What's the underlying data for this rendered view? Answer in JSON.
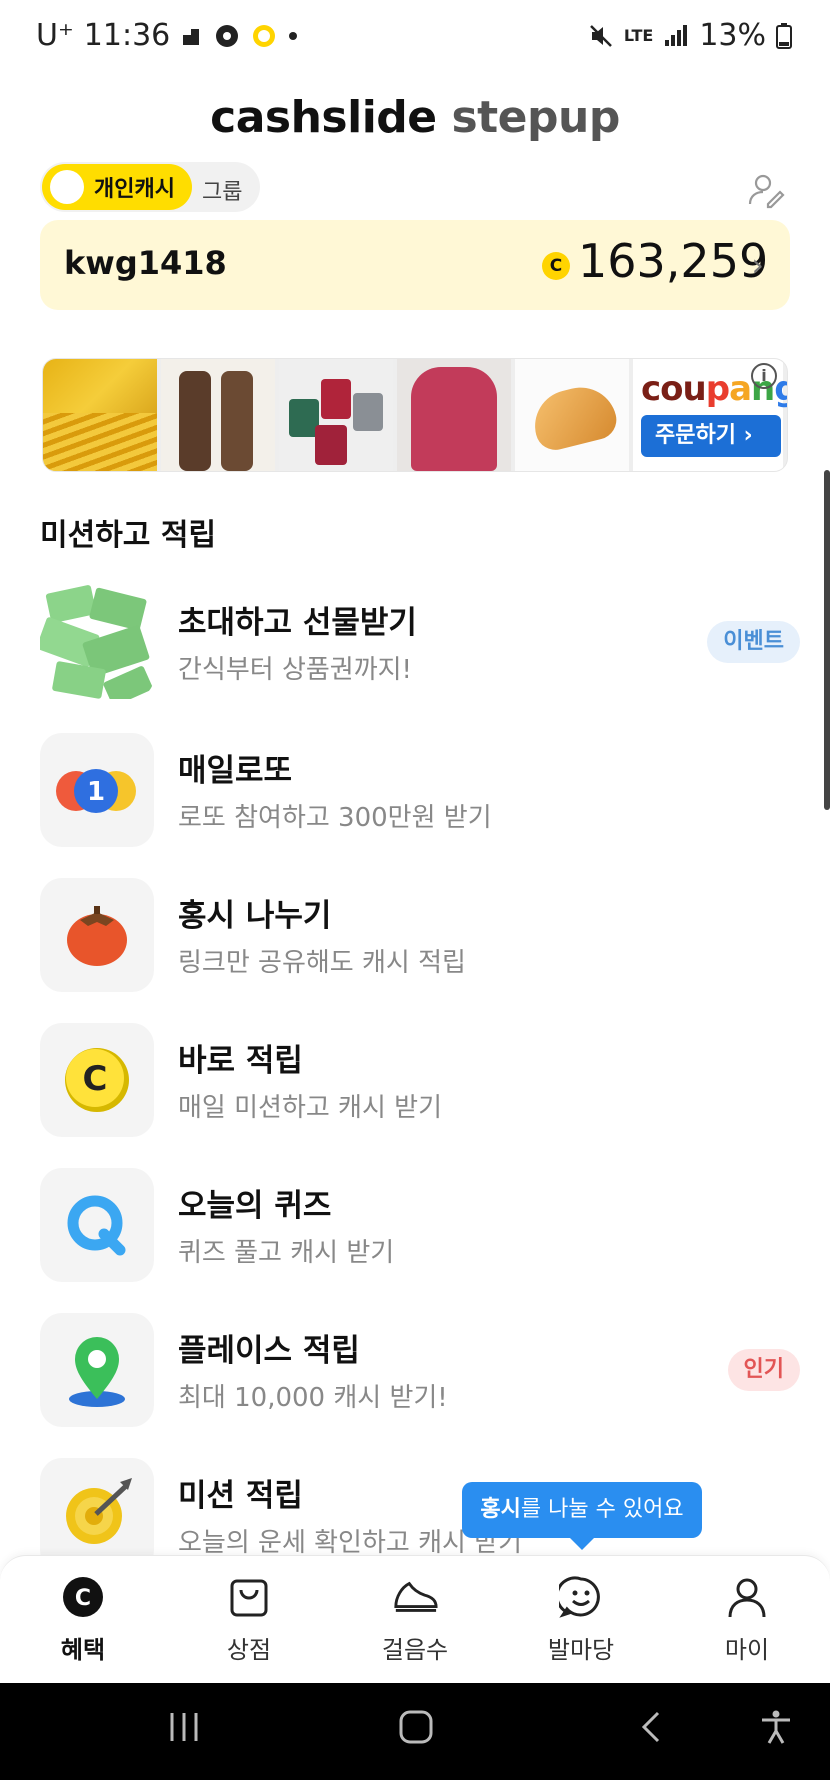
{
  "status_bar": {
    "carrier": "U⁺",
    "time": "11:36",
    "network": "LTE",
    "battery": "13%"
  },
  "header": {
    "title_part1": "cashslide",
    "title_part2": "stepup"
  },
  "toggle": {
    "active_label": "개인캐시",
    "inactive_label": "그룹"
  },
  "account": {
    "user_id": "kwg1418",
    "coin_symbol": "C",
    "balance": "163,259"
  },
  "ad": {
    "brand_parts": [
      "cou",
      "p",
      "a",
      "n",
      "g"
    ],
    "order_button": "주문하기 ›",
    "info": "i"
  },
  "section": {
    "title": "미션하고 적립"
  },
  "missions": [
    {
      "title": "초대하고 선물받기",
      "subtitle": "간식부터 상품권까지!",
      "badge": "이벤트",
      "icon": "money-icon"
    },
    {
      "title": "매일로또",
      "subtitle": "로또 참여하고 300만원 받기",
      "badge": "",
      "icon": "lotto-ball-icon"
    },
    {
      "title": "홍시 나누기",
      "subtitle": "링크만 공유해도 캐시 적립",
      "badge": "",
      "icon": "persimmon-icon"
    },
    {
      "title": "바로 적립",
      "subtitle": "매일 미션하고 캐시 받기",
      "badge": "",
      "icon": "coin-icon"
    },
    {
      "title": "오늘의 퀴즈",
      "subtitle": "퀴즈 풀고 캐시 받기",
      "badge": "",
      "icon": "quiz-icon"
    },
    {
      "title": "플레이스 적립",
      "subtitle": "최대 10,000 캐시 받기!",
      "badge": "인기",
      "icon": "map-pin-icon"
    },
    {
      "title": "미션 적립",
      "subtitle": "오늘의 운세 확인하고 캐시 받기",
      "badge": "",
      "icon": "target-icon"
    }
  ],
  "tooltip": {
    "bold": "홍시",
    "rest": "를 나눌 수 있어요"
  },
  "nav": {
    "items": [
      {
        "label": "혜택",
        "icon": "benefit-coin-icon"
      },
      {
        "label": "상점",
        "icon": "shopping-bag-icon"
      },
      {
        "label": "걸음수",
        "icon": "sneaker-icon"
      },
      {
        "label": "발마당",
        "icon": "smile-chat-icon"
      },
      {
        "label": "마이",
        "icon": "person-icon"
      }
    ]
  },
  "colors": {
    "accent_yellow": "#ffdd00",
    "balance_bg": "#fff8d6",
    "tooltip_blue": "#2a8ef0",
    "event_badge": "#4a8fd6",
    "popular_badge": "#e25555"
  }
}
